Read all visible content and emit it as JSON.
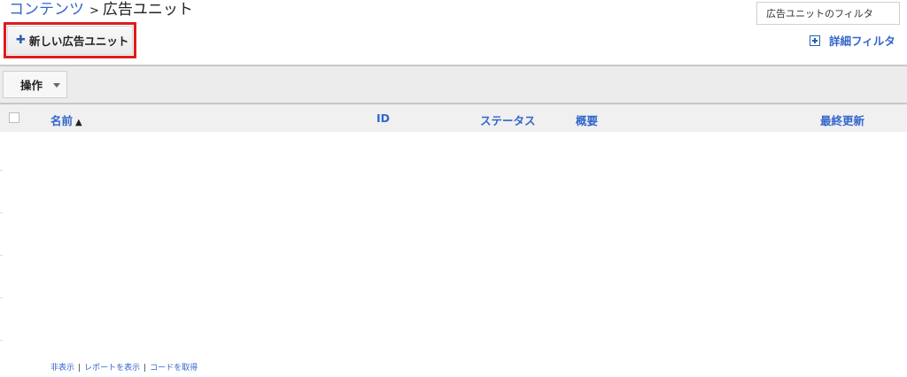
{
  "breadcrumb": {
    "parent": "コンテンツ",
    "separator": ">",
    "current": "広告ユニット"
  },
  "filter": {
    "placeholder": "広告ユニットのフィルタ"
  },
  "toolbar": {
    "new_ad_unit_label": "新しい広告ユニット",
    "new_ad_unit_icon": "plus-icon",
    "advanced_filter_label": "詳細フィルタ",
    "advanced_filter_icon": "plus-box-icon",
    "actions_label": "操作",
    "actions_icon": "caret-down-icon"
  },
  "table": {
    "columns": {
      "name": "名前",
      "name_sort_icon": "arrow-up-icon",
      "id": "ID",
      "status": "ステータス",
      "overview": "概要",
      "last_updated": "最終更新"
    },
    "rows": []
  },
  "footer": {
    "hide": "非表示",
    "show_report": "レポートを表示",
    "get_code": "コードを取得",
    "separator": "|"
  },
  "colors": {
    "link": "#3366cc",
    "highlight": "#e01b1b",
    "toolbar_bg": "#ececec",
    "header_bg": "#f0f0f0"
  }
}
